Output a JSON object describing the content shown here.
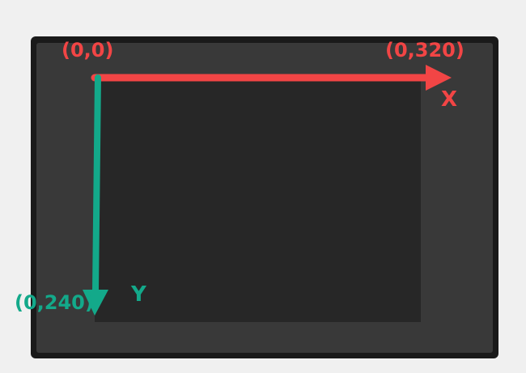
{
  "colors": {
    "page_background": "#f0f0f0",
    "frame_outer": "#1a1a1a",
    "frame_inner": "#393939",
    "screen_area": "#272727",
    "x_axis": "#f24545",
    "y_axis": "#13a98a"
  },
  "labels": {
    "origin": "(0,0)",
    "x_end": "(0,320)",
    "x_axis": "X",
    "y_end": "(0,240)",
    "y_axis": "Y"
  }
}
